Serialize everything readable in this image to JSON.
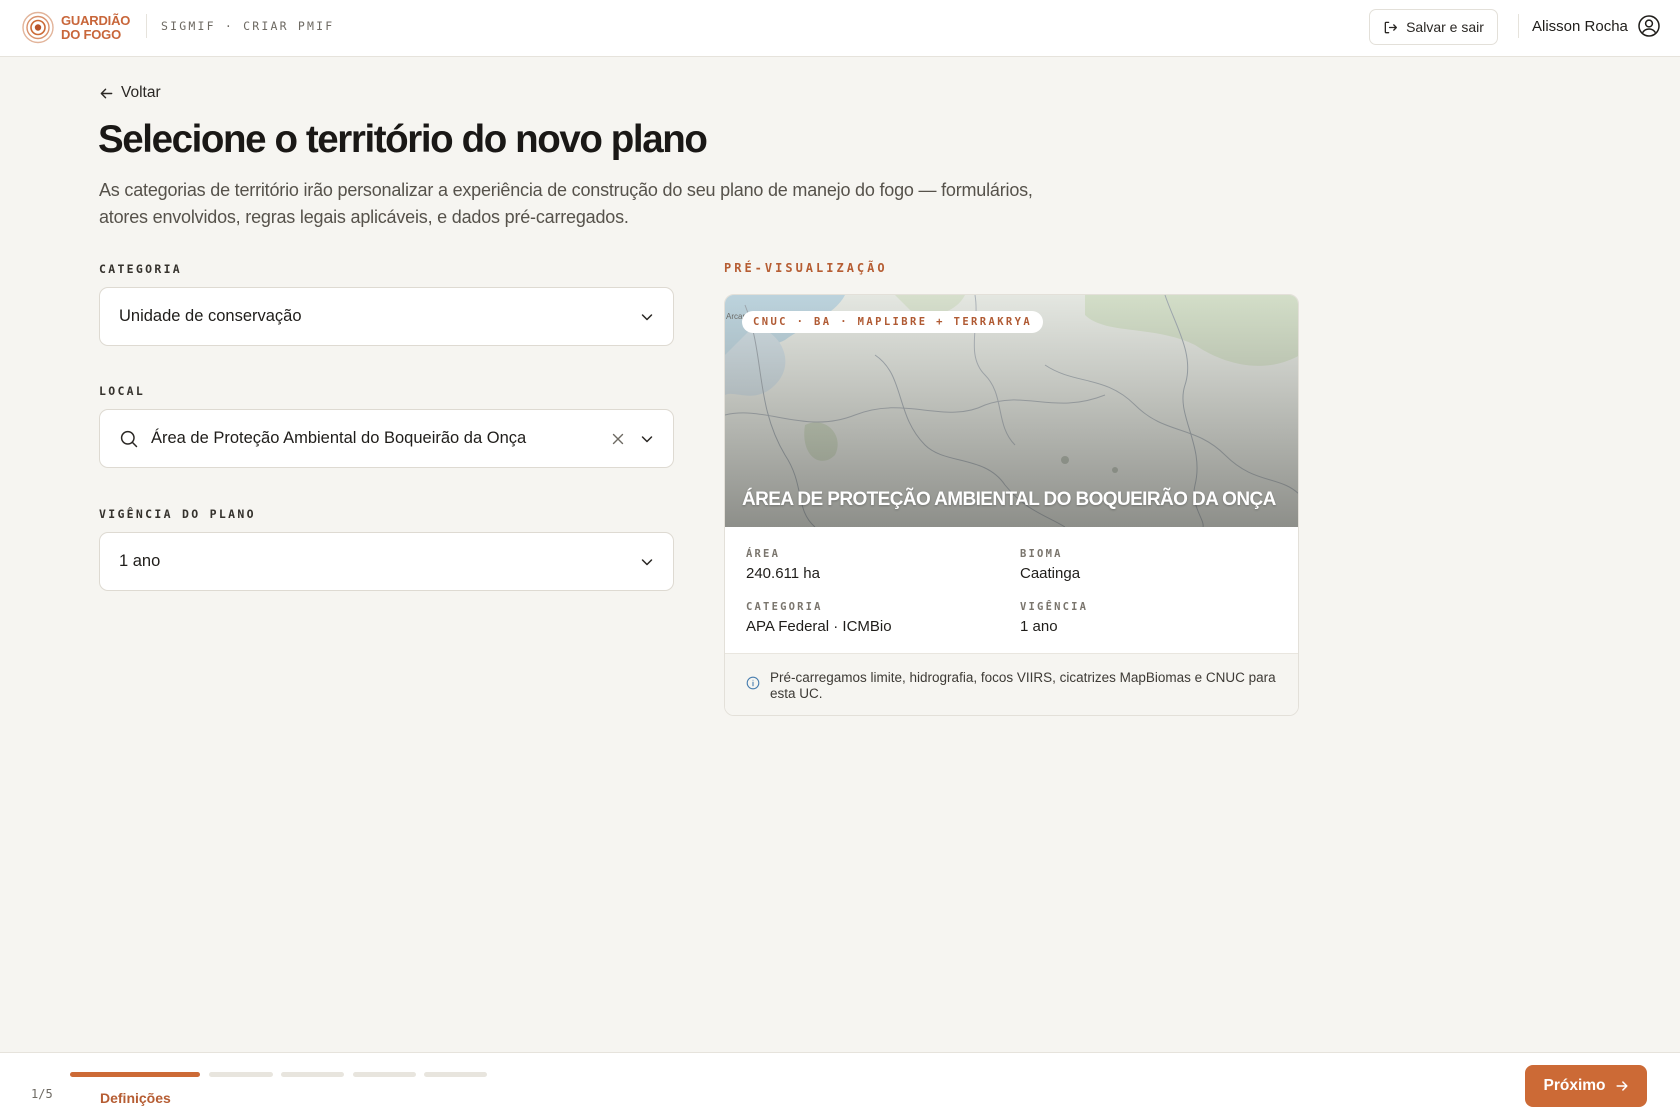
{
  "header": {
    "brand_line1": "GUARDIÃO",
    "brand_line2": "DO FOGO",
    "breadcrumb": "SIGMIF · CRIAR PMIF",
    "save_label": "Salvar e sair",
    "user_name": "Alisson Rocha"
  },
  "main": {
    "back_label": "Voltar",
    "title": "Selecione o território do novo plano",
    "description": "As categorias de território irão personalizar a experiência de construção do seu plano de manejo do fogo — formulários, atores envolvidos, regras legais aplicáveis, e dados pré-carregados."
  },
  "form": {
    "category": {
      "label": "CATEGORIA",
      "value": "Unidade de conservação"
    },
    "local": {
      "label": "LOCAL",
      "value": "Área de Proteção Ambiental do Boqueirão da Onça"
    },
    "validity": {
      "label": "VIGÊNCIA DO PLANO",
      "value": "1 ano"
    }
  },
  "preview": {
    "label": "PRÉ-VISUALIZAÇÃO",
    "map_tag": "CNUC · BA · MAPLIBRE + TERRAKRYA",
    "map_edge_label": "Arcar",
    "map_title": "ÁREA DE PROTEÇÃO AMBIENTAL DO BOQUEIRÃO DA ONÇA",
    "stats": [
      {
        "key": "ÁREA",
        "value": "240.611 ha"
      },
      {
        "key": "BIOMA",
        "value": "Caatinga"
      },
      {
        "key": "CATEGORIA",
        "value": "APA Federal · ICMBio"
      },
      {
        "key": "VIGÊNCIA",
        "value": "1 ano"
      }
    ],
    "notice": "Pré-carregamos limite, hidrografia, focos VIIRS, cicatrizes MapBiomas e CNUC para esta UC."
  },
  "footer": {
    "step_count": "1/5",
    "step_name": "Definições",
    "current_step": 1,
    "total_steps": 5,
    "next_label": "Próximo"
  },
  "colors": {
    "accent": "#cc6a36",
    "accent_text": "#b65d33",
    "background": "#f6f5f1"
  },
  "icons": {
    "logo": "concentric-circles-logo",
    "save": "logout-icon",
    "user": "user-circle-icon",
    "back": "arrow-left-icon",
    "select": "chevron-down-icon",
    "search": "search-icon",
    "clear": "close-icon",
    "info": "info-icon",
    "next": "arrow-right-icon"
  }
}
